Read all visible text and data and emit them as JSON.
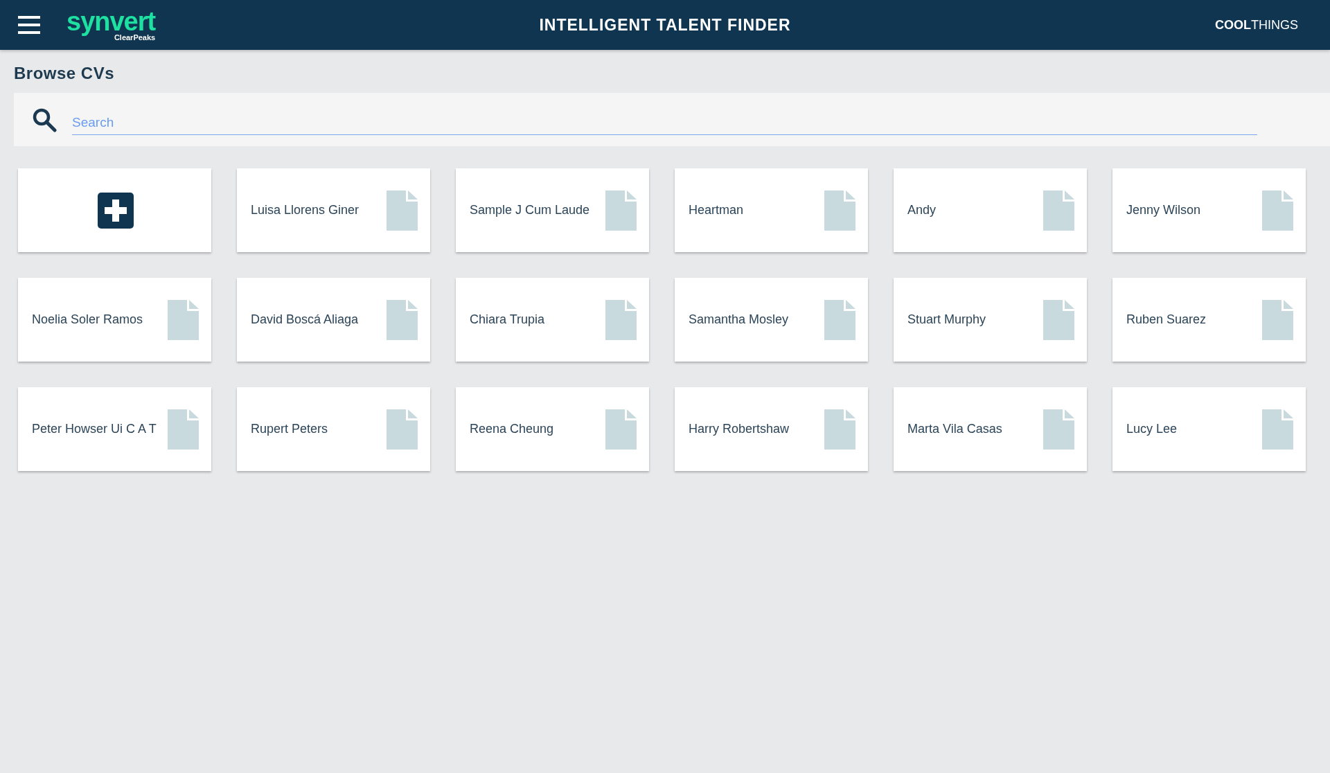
{
  "header": {
    "logo": {
      "name": "synvert",
      "tagline": "ClearPeaks"
    },
    "title": "INTELLIGENT TALENT FINDER",
    "brand": "**COOL**THINGS"
  },
  "page_title": "Browse CVs",
  "search": {
    "placeholder": "Search"
  },
  "cards": [
    {
      "kind": "add"
    },
    {
      "kind": "cv",
      "name": "Luisa Llorens Giner"
    },
    {
      "kind": "cv",
      "name": "Sample J Cum Laude"
    },
    {
      "kind": "cv",
      "name": "Heartman"
    },
    {
      "kind": "cv",
      "name": "Andy"
    },
    {
      "kind": "cv",
      "name": "Jenny Wilson"
    },
    {
      "kind": "cv",
      "name": "Noelia Soler Ramos"
    },
    {
      "kind": "cv",
      "name": "David Boscá Aliaga"
    },
    {
      "kind": "cv",
      "name": "Chiara Trupia"
    },
    {
      "kind": "cv",
      "name": "Samantha Mosley"
    },
    {
      "kind": "cv",
      "name": "Stuart Murphy"
    },
    {
      "kind": "cv",
      "name": "Ruben Suarez"
    },
    {
      "kind": "cv",
      "name": "Peter Howser Ui C A T"
    },
    {
      "kind": "cv",
      "name": "Rupert Peters"
    },
    {
      "kind": "cv",
      "name": "Reena Cheung"
    },
    {
      "kind": "cv",
      "name": "Harry Robertshaw"
    },
    {
      "kind": "cv",
      "name": "Marta Vila Casas"
    },
    {
      "kind": "cv",
      "name": "Lucy Lee"
    }
  ]
}
